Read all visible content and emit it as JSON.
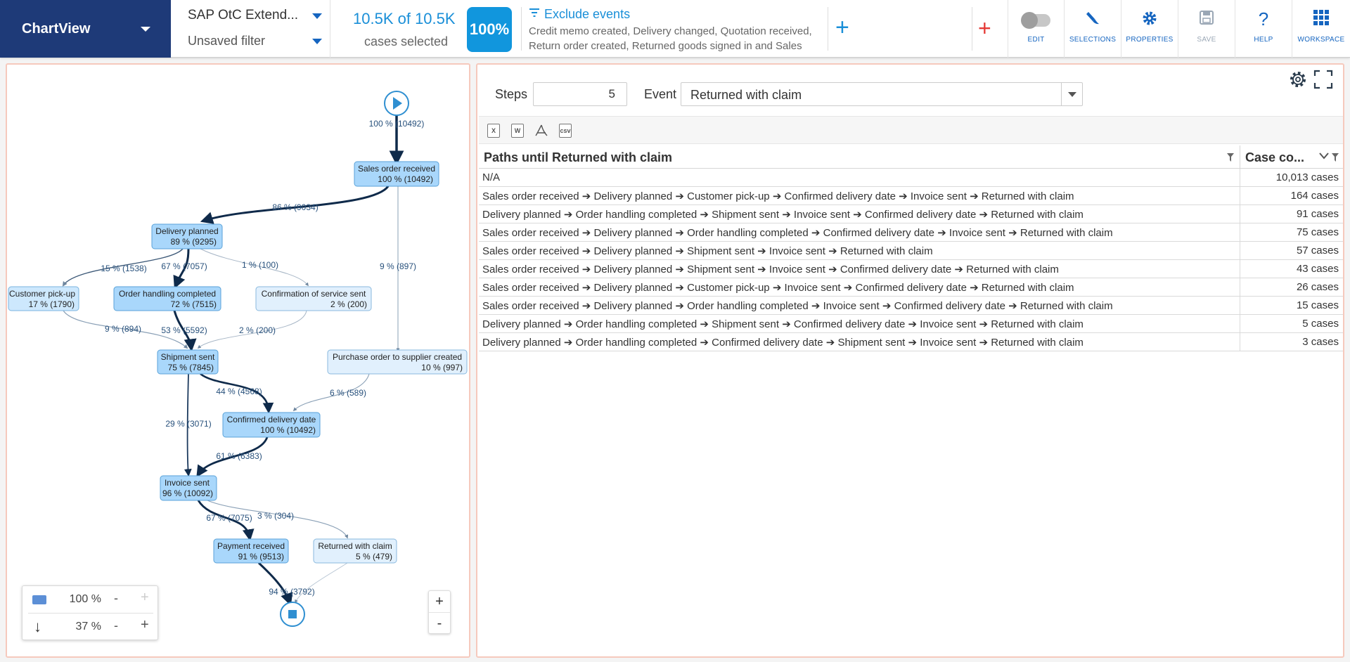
{
  "app": {
    "title": "ChartView"
  },
  "filter": {
    "name": "SAP OtC Extend...",
    "subtitle": "Unsaved filter"
  },
  "cases": {
    "count": "10.5K of 10.5K",
    "label": "cases selected",
    "percent": "100%"
  },
  "exclude": {
    "title": "Exclude events",
    "desc": "Credit memo created, Delivery changed, Quotation received, Return order created, Returned goods signed in and Sales"
  },
  "toolbar": {
    "edit": "EDIT",
    "selections": "SELECTIONS",
    "properties": "PROPERTIES",
    "save": "SAVE",
    "help": "HELP",
    "workspace": "WORKSPACE"
  },
  "colors": {
    "brand": "#1e3a78",
    "accent": "#1a8fd8",
    "node": "#a9d7fb",
    "node_light": "#e1f0fd",
    "edge": "#0f2a4a"
  },
  "process_map": {
    "start_label": "100 % (10492)",
    "nodes": [
      {
        "id": "sales_order",
        "name": "Sales order received",
        "stat": "100 % (10492)"
      },
      {
        "id": "delivery_planned",
        "name": "Delivery planned",
        "stat": "89 % (9295)"
      },
      {
        "id": "customer_pickup",
        "name": "Customer pick-up",
        "stat": "17 % (1790)"
      },
      {
        "id": "order_handling",
        "name": "Order handling completed",
        "stat": "72 % (7515)"
      },
      {
        "id": "confirmation_service",
        "name": "Confirmation of service sent",
        "stat": "2 % (200)"
      },
      {
        "id": "shipment_sent",
        "name": "Shipment sent",
        "stat": "75 % (7845)"
      },
      {
        "id": "purchase_order",
        "name": "Purchase order to supplier created",
        "stat": "10 % (997)"
      },
      {
        "id": "confirmed_delivery",
        "name": "Confirmed delivery date",
        "stat": "100 % (10492)"
      },
      {
        "id": "invoice_sent",
        "name": "Invoice sent",
        "stat": "96 % (10092)"
      },
      {
        "id": "payment_received",
        "name": "Payment received",
        "stat": "91 % (9513)"
      },
      {
        "id": "returned_claim",
        "name": "Returned with claim",
        "stat": "5 % (479)"
      }
    ],
    "edges": [
      "86 % (9034)",
      "9 % (897)",
      "15 % (1538)",
      "67 % (7057)",
      "1 % (100)",
      "9 % (894)",
      "53 % (5592)",
      "2 % (200)",
      "44 % (4568)",
      "6 % (589)",
      "29 % (3071)",
      "61 % (6383)",
      "67 % (7075)",
      "3 % (304)",
      "94 % (3792)"
    ],
    "zoom": {
      "size_value": "100 %",
      "flow_value": "37 %",
      "minus": "-",
      "plus": "+"
    }
  },
  "analysis": {
    "steps_label": "Steps",
    "steps_value": "5",
    "event_label": "Event",
    "event_value": "Returned with claim",
    "export_icons": [
      "X",
      "W",
      "pdf",
      "csv"
    ],
    "table": {
      "col1": "Paths until Returned with claim",
      "col2": "Case co...",
      "rows": [
        {
          "path": "N/A",
          "cases": "10,013 cases"
        },
        {
          "path": "Sales order received ➔ Delivery planned ➔ Customer pick-up ➔ Confirmed delivery date ➔ Invoice sent ➔ Returned with claim",
          "cases": "164 cases"
        },
        {
          "path": "Delivery planned ➔ Order handling completed ➔ Shipment sent ➔ Invoice sent ➔ Confirmed delivery date ➔ Returned with claim",
          "cases": "91 cases"
        },
        {
          "path": "Sales order received ➔ Delivery planned ➔ Order handling completed ➔ Confirmed delivery date ➔ Invoice sent ➔ Returned with claim",
          "cases": "75 cases"
        },
        {
          "path": "Sales order received ➔ Delivery planned ➔ Shipment sent ➔ Invoice sent ➔ Returned with claim",
          "cases": "57 cases"
        },
        {
          "path": "Sales order received ➔ Delivery planned ➔ Shipment sent ➔ Invoice sent ➔ Confirmed delivery date ➔ Returned with claim",
          "cases": "43 cases"
        },
        {
          "path": "Sales order received ➔ Delivery planned ➔ Customer pick-up ➔ Invoice sent ➔ Confirmed delivery date ➔ Returned with claim",
          "cases": "26 cases"
        },
        {
          "path": "Sales order received ➔ Delivery planned ➔ Order handling completed ➔ Invoice sent ➔ Confirmed delivery date ➔ Returned with claim",
          "cases": "15 cases"
        },
        {
          "path": "Delivery planned ➔ Order handling completed ➔ Shipment sent ➔ Confirmed delivery date ➔ Invoice sent ➔ Returned with claim",
          "cases": "5 cases"
        },
        {
          "path": "Delivery planned ➔ Order handling completed ➔ Confirmed delivery date ➔ Shipment sent ➔ Invoice sent ➔ Returned with claim",
          "cases": "3 cases"
        }
      ]
    }
  }
}
